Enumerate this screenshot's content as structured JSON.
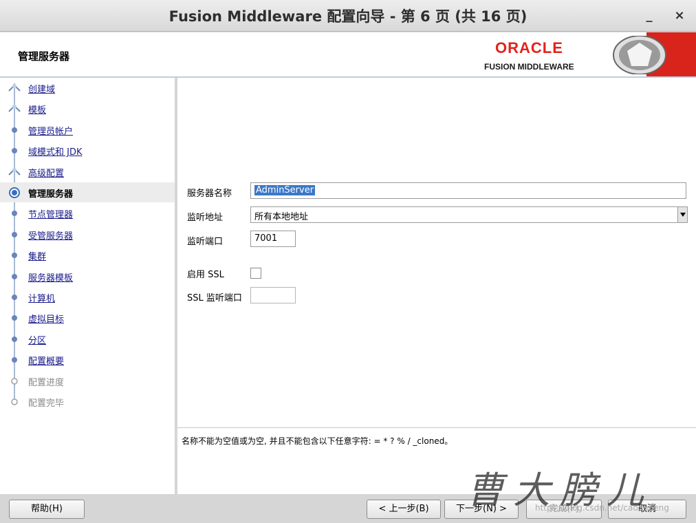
{
  "window": {
    "title": "Fusion Middleware 配置向导 - 第 6 页 (共 16 页)",
    "minimize": "_",
    "close": "×"
  },
  "header": {
    "page_name": "管理服务器",
    "brand_name": "ORACLE",
    "brand_sub": "FUSION MIDDLEWARE",
    "brand_color": "#e2231a"
  },
  "steps": [
    {
      "label": "创建域",
      "state": "done"
    },
    {
      "label": "模板",
      "state": "done"
    },
    {
      "label": "管理员帐户",
      "state": "pending"
    },
    {
      "label": "域模式和 JDK",
      "state": "pending"
    },
    {
      "label": "高级配置",
      "state": "done"
    },
    {
      "label": "管理服务器",
      "state": "current"
    },
    {
      "label": "节点管理器",
      "state": "pending"
    },
    {
      "label": "受管服务器",
      "state": "pending"
    },
    {
      "label": "集群",
      "state": "pending"
    },
    {
      "label": "服务器模板",
      "state": "pending"
    },
    {
      "label": "计算机",
      "state": "pending"
    },
    {
      "label": "虚拟目标",
      "state": "pending"
    },
    {
      "label": "分区",
      "state": "pending"
    },
    {
      "label": "配置概要",
      "state": "pending"
    },
    {
      "label": "配置进度",
      "state": "future"
    },
    {
      "label": "配置完毕",
      "state": "future"
    }
  ],
  "form": {
    "server_name_label": "服务器名称",
    "server_name_value": "AdminServer",
    "listen_address_label": "监听地址",
    "listen_address_value": "所有本地地址",
    "listen_port_label": "监听端口",
    "listen_port_value": "7001",
    "enable_ssl_label": "启用 SSL",
    "enable_ssl_checked": false,
    "ssl_port_label": "SSL 监听端口",
    "ssl_port_value": ""
  },
  "message": "名称不能为空值或为空, 并且不能包含以下任意字符: = * ? % / _cloned。",
  "footer": {
    "help": "帮助(H)",
    "back": "< 上一步(B)",
    "next": "下一步(N) >",
    "finish": "完成(F)",
    "cancel": "取消"
  },
  "watermark": {
    "text": "曹大膀儿",
    "url": "https://blog.csdn.net/caodapeng"
  }
}
